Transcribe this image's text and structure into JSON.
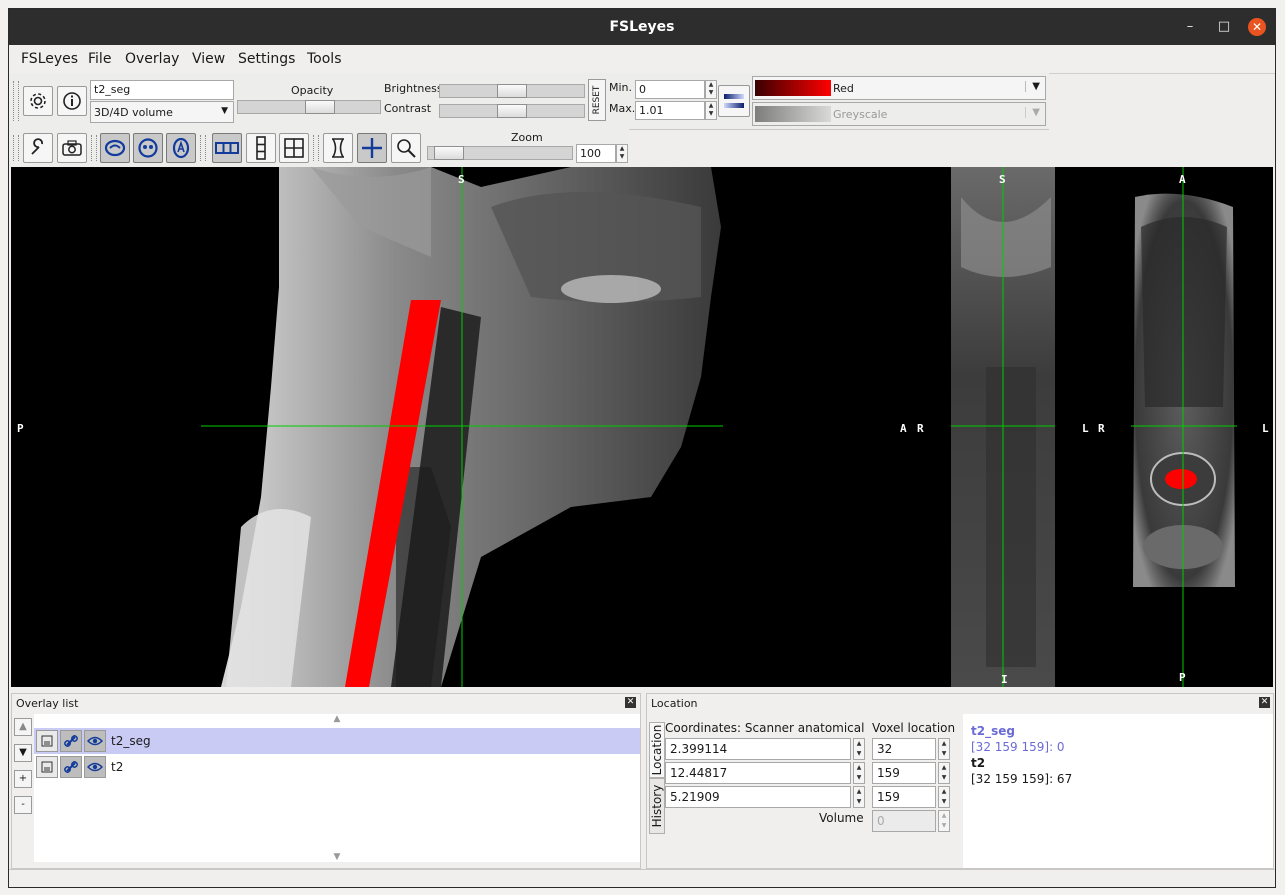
{
  "window": {
    "title": "FSLeyes"
  },
  "menu": [
    "FSLeyes",
    "File",
    "Overlay",
    "View",
    "Settings",
    "Tools"
  ],
  "overlay_toolbar": {
    "name_value": "t2_seg",
    "type_value": "3D/4D volume",
    "opacity_label": "Opacity",
    "opacity": 0.6,
    "brightness_label": "Brightness",
    "brightness": 0.5,
    "contrast_label": "Contrast",
    "contrast": 0.5,
    "reset_label": "RESET",
    "min_label": "Min.",
    "min_value": "0",
    "max_label": "Max.",
    "max_value": "1.01",
    "cmap_primary": "Red",
    "cmap_secondary": "Greyscale"
  },
  "ortho_toolbar": {
    "zoom_label": "Zoom",
    "zoom_value": "100",
    "zoom": 0.05
  },
  "views": {
    "sagittal": {
      "top": "S",
      "left": "P"
    },
    "coronal": {
      "top": "S",
      "left": "A",
      "right": "R",
      "bottom": "I"
    },
    "axial": {
      "top": "A",
      "left": "L",
      "right": "R",
      "edge_right": "L",
      "bottom": "P"
    }
  },
  "overlay_list": {
    "title": "Overlay list",
    "items": [
      {
        "name": "t2_seg",
        "selected": true
      },
      {
        "name": "t2",
        "selected": false
      }
    ],
    "controls": [
      "▲",
      "▼",
      "+",
      "-"
    ]
  },
  "location": {
    "title": "Location",
    "tabs": [
      "Location",
      "History"
    ],
    "coord_header": "Coordinates: Scanner anatomical",
    "voxel_header": "Voxel location",
    "coords": [
      "2.399114",
      "12.44817",
      "5.21909"
    ],
    "voxels": [
      "32",
      "159",
      "159"
    ],
    "volume_label": "Volume",
    "volume_value": "0",
    "info": [
      {
        "name": "t2_seg",
        "value": "[32 159 159]: 0"
      },
      {
        "name": "t2",
        "value": "[32 159 159]: 67"
      }
    ]
  },
  "colors": {
    "accent_red": "#ff0000",
    "cursor_green": "#00cc00",
    "selected_row": "#c9cbf5",
    "titlebar": "#2d2d2d",
    "close_button": "#e95420"
  }
}
